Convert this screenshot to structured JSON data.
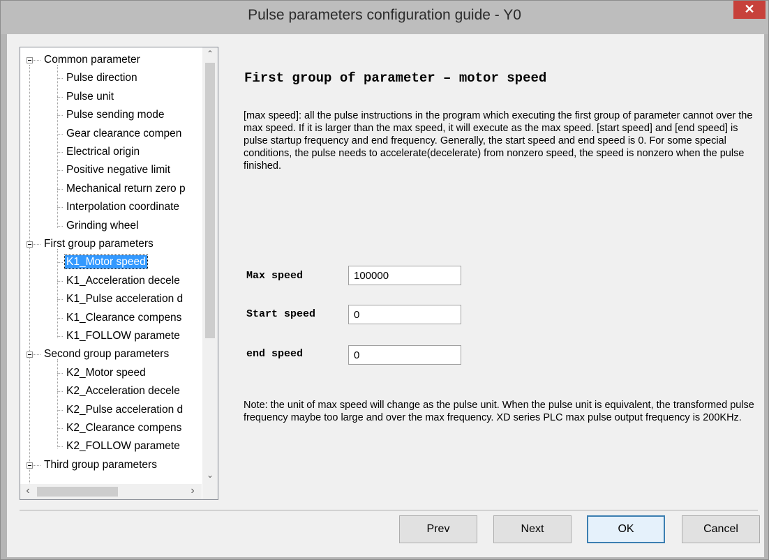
{
  "window": {
    "title": "Pulse parameters configuration guide - Y0",
    "close_glyph": "✕"
  },
  "tree": {
    "groups": [
      {
        "label": "Common parameter",
        "children": [
          "Pulse direction",
          "Pulse unit",
          "Pulse sending mode",
          "Gear clearance compen",
          "Electrical origin",
          "Positive negative limit",
          "Mechanical return zero p",
          "Interpolation coordinate",
          "Grinding wheel"
        ]
      },
      {
        "label": "First group parameters",
        "children": [
          "K1_Motor speed",
          "K1_Acceleration decele",
          "K1_Pulse acceleration d",
          "K1_Clearance compens",
          "K1_FOLLOW paramete"
        ]
      },
      {
        "label": "Second group parameters",
        "children": [
          "K2_Motor speed",
          "K2_Acceleration decele",
          "K2_Pulse acceleration d",
          "K2_Clearance compens",
          "K2_FOLLOW paramete"
        ]
      },
      {
        "label": "Third group parameters",
        "children": []
      }
    ],
    "selected": "K1_Motor speed"
  },
  "content": {
    "heading": "First group of parameter – motor speed",
    "description": "[max speed]: all the pulse instructions in the program which executing the first group of parameter cannot over the max speed. If it is larger than the max speed, it will execute as the max speed. [start speed] and [end speed] is pulse startup frequency and end frequency. Generally, the start speed and end speed is 0. For some special conditions, the pulse needs to accelerate(decelerate) from nonzero speed, the speed is nonzero when the pulse finished.",
    "fields": {
      "max_speed": {
        "label": "Max speed",
        "value": "100000"
      },
      "start_speed": {
        "label": "Start speed",
        "value": "0"
      },
      "end_speed": {
        "label": "end speed",
        "value": "0"
      }
    },
    "note": "Note: the unit of max speed will change as the pulse unit. When the pulse unit is equivalent, the transformed pulse frequency maybe too large and over the max frequency. XD series PLC max pulse output frequency is 200KHz."
  },
  "buttons": {
    "prev": "Prev",
    "next": "Next",
    "ok": "OK",
    "cancel": "Cancel"
  },
  "icons": {
    "scroll_up": "up-arrow-icon",
    "scroll_down": "down-arrow-icon",
    "scroll_left": "left-arrow-icon",
    "scroll_right": "right-arrow-icon"
  },
  "colors": {
    "selection": "#3399ff",
    "close_button": "#c7413b",
    "default_button_border": "#3c7fb1"
  }
}
